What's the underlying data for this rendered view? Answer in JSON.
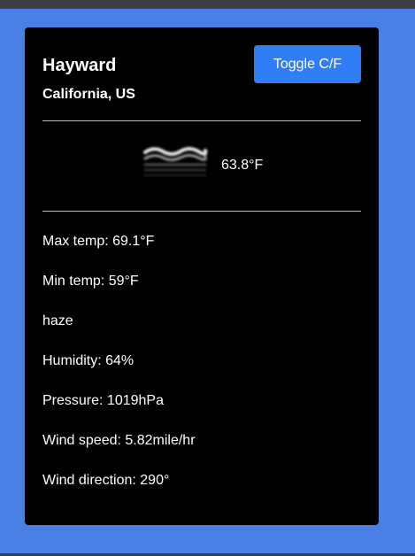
{
  "location": {
    "city": "Hayward",
    "region": "California, US"
  },
  "toggle_button_label": "Toggle C/F",
  "current": {
    "icon": "haze-icon",
    "temperature": "63.8°F"
  },
  "details": [
    "Max temp: 69.1°F",
    "Min temp: 59°F",
    "haze",
    "Humidity: 64%",
    "Pressure: 1019hPa",
    "Wind speed: 5.82mile/hr",
    "Wind direction: 290°"
  ],
  "colors": {
    "page_background": "#4a7fe6",
    "card_background": "#000000",
    "button": "#2f7ef6",
    "text": "#ffffff"
  }
}
